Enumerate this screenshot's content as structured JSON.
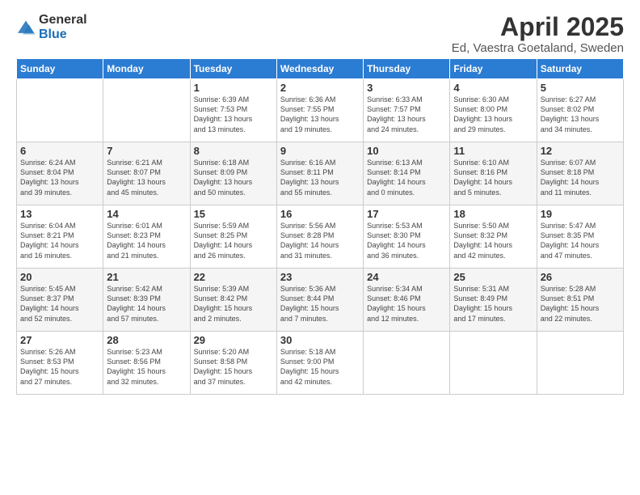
{
  "logo": {
    "general": "General",
    "blue": "Blue"
  },
  "header": {
    "title": "April 2025",
    "subtitle": "Ed, Vaestra Goetaland, Sweden"
  },
  "weekdays": [
    "Sunday",
    "Monday",
    "Tuesday",
    "Wednesday",
    "Thursday",
    "Friday",
    "Saturday"
  ],
  "weeks": [
    [
      {
        "day": "",
        "info": ""
      },
      {
        "day": "",
        "info": ""
      },
      {
        "day": "1",
        "info": "Sunrise: 6:39 AM\nSunset: 7:53 PM\nDaylight: 13 hours\nand 13 minutes."
      },
      {
        "day": "2",
        "info": "Sunrise: 6:36 AM\nSunset: 7:55 PM\nDaylight: 13 hours\nand 19 minutes."
      },
      {
        "day": "3",
        "info": "Sunrise: 6:33 AM\nSunset: 7:57 PM\nDaylight: 13 hours\nand 24 minutes."
      },
      {
        "day": "4",
        "info": "Sunrise: 6:30 AM\nSunset: 8:00 PM\nDaylight: 13 hours\nand 29 minutes."
      },
      {
        "day": "5",
        "info": "Sunrise: 6:27 AM\nSunset: 8:02 PM\nDaylight: 13 hours\nand 34 minutes."
      }
    ],
    [
      {
        "day": "6",
        "info": "Sunrise: 6:24 AM\nSunset: 8:04 PM\nDaylight: 13 hours\nand 39 minutes."
      },
      {
        "day": "7",
        "info": "Sunrise: 6:21 AM\nSunset: 8:07 PM\nDaylight: 13 hours\nand 45 minutes."
      },
      {
        "day": "8",
        "info": "Sunrise: 6:18 AM\nSunset: 8:09 PM\nDaylight: 13 hours\nand 50 minutes."
      },
      {
        "day": "9",
        "info": "Sunrise: 6:16 AM\nSunset: 8:11 PM\nDaylight: 13 hours\nand 55 minutes."
      },
      {
        "day": "10",
        "info": "Sunrise: 6:13 AM\nSunset: 8:14 PM\nDaylight: 14 hours\nand 0 minutes."
      },
      {
        "day": "11",
        "info": "Sunrise: 6:10 AM\nSunset: 8:16 PM\nDaylight: 14 hours\nand 5 minutes."
      },
      {
        "day": "12",
        "info": "Sunrise: 6:07 AM\nSunset: 8:18 PM\nDaylight: 14 hours\nand 11 minutes."
      }
    ],
    [
      {
        "day": "13",
        "info": "Sunrise: 6:04 AM\nSunset: 8:21 PM\nDaylight: 14 hours\nand 16 minutes."
      },
      {
        "day": "14",
        "info": "Sunrise: 6:01 AM\nSunset: 8:23 PM\nDaylight: 14 hours\nand 21 minutes."
      },
      {
        "day": "15",
        "info": "Sunrise: 5:59 AM\nSunset: 8:25 PM\nDaylight: 14 hours\nand 26 minutes."
      },
      {
        "day": "16",
        "info": "Sunrise: 5:56 AM\nSunset: 8:28 PM\nDaylight: 14 hours\nand 31 minutes."
      },
      {
        "day": "17",
        "info": "Sunrise: 5:53 AM\nSunset: 8:30 PM\nDaylight: 14 hours\nand 36 minutes."
      },
      {
        "day": "18",
        "info": "Sunrise: 5:50 AM\nSunset: 8:32 PM\nDaylight: 14 hours\nand 42 minutes."
      },
      {
        "day": "19",
        "info": "Sunrise: 5:47 AM\nSunset: 8:35 PM\nDaylight: 14 hours\nand 47 minutes."
      }
    ],
    [
      {
        "day": "20",
        "info": "Sunrise: 5:45 AM\nSunset: 8:37 PM\nDaylight: 14 hours\nand 52 minutes."
      },
      {
        "day": "21",
        "info": "Sunrise: 5:42 AM\nSunset: 8:39 PM\nDaylight: 14 hours\nand 57 minutes."
      },
      {
        "day": "22",
        "info": "Sunrise: 5:39 AM\nSunset: 8:42 PM\nDaylight: 15 hours\nand 2 minutes."
      },
      {
        "day": "23",
        "info": "Sunrise: 5:36 AM\nSunset: 8:44 PM\nDaylight: 15 hours\nand 7 minutes."
      },
      {
        "day": "24",
        "info": "Sunrise: 5:34 AM\nSunset: 8:46 PM\nDaylight: 15 hours\nand 12 minutes."
      },
      {
        "day": "25",
        "info": "Sunrise: 5:31 AM\nSunset: 8:49 PM\nDaylight: 15 hours\nand 17 minutes."
      },
      {
        "day": "26",
        "info": "Sunrise: 5:28 AM\nSunset: 8:51 PM\nDaylight: 15 hours\nand 22 minutes."
      }
    ],
    [
      {
        "day": "27",
        "info": "Sunrise: 5:26 AM\nSunset: 8:53 PM\nDaylight: 15 hours\nand 27 minutes."
      },
      {
        "day": "28",
        "info": "Sunrise: 5:23 AM\nSunset: 8:56 PM\nDaylight: 15 hours\nand 32 minutes."
      },
      {
        "day": "29",
        "info": "Sunrise: 5:20 AM\nSunset: 8:58 PM\nDaylight: 15 hours\nand 37 minutes."
      },
      {
        "day": "30",
        "info": "Sunrise: 5:18 AM\nSunset: 9:00 PM\nDaylight: 15 hours\nand 42 minutes."
      },
      {
        "day": "",
        "info": ""
      },
      {
        "day": "",
        "info": ""
      },
      {
        "day": "",
        "info": ""
      }
    ]
  ]
}
